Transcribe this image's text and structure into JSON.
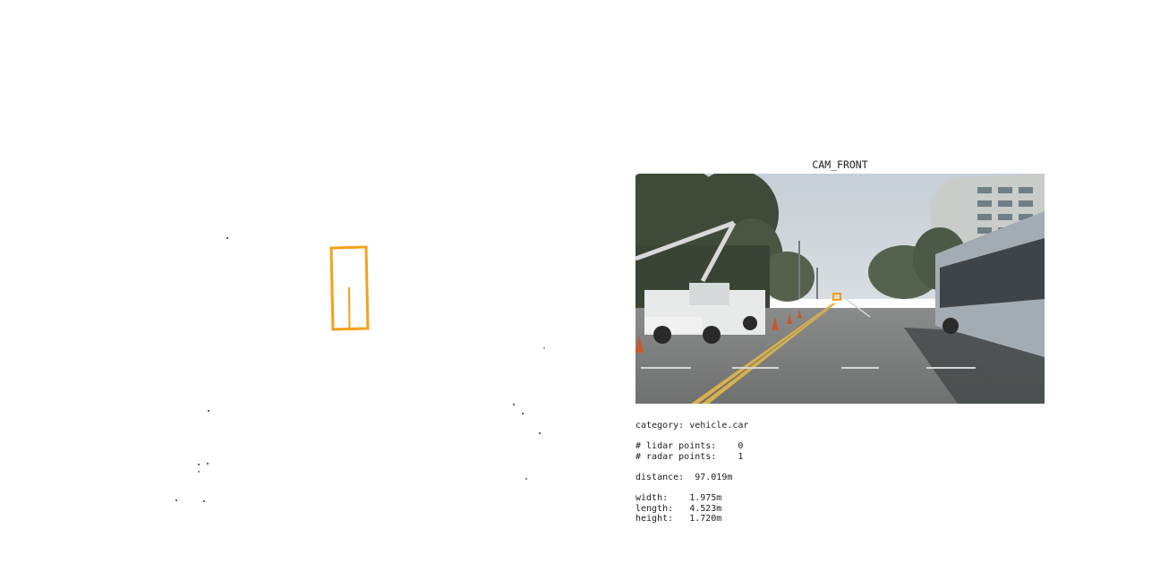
{
  "camera": {
    "title": "CAM_FRONT"
  },
  "annotation": {
    "category": "category: vehicle.car",
    "lidar_points": "# lidar points:    0",
    "radar_points": "# radar points:    1",
    "distance": "distance:  97.019m",
    "width": "width:    1.975m",
    "length": "length:   4.523m",
    "height": "height:   1.720m"
  },
  "colors": {
    "box": "#f5a01a",
    "points": "#333333"
  },
  "icons": {
    "bev_box": "bounding-box-icon",
    "cam_box": "bounding-box-icon"
  }
}
